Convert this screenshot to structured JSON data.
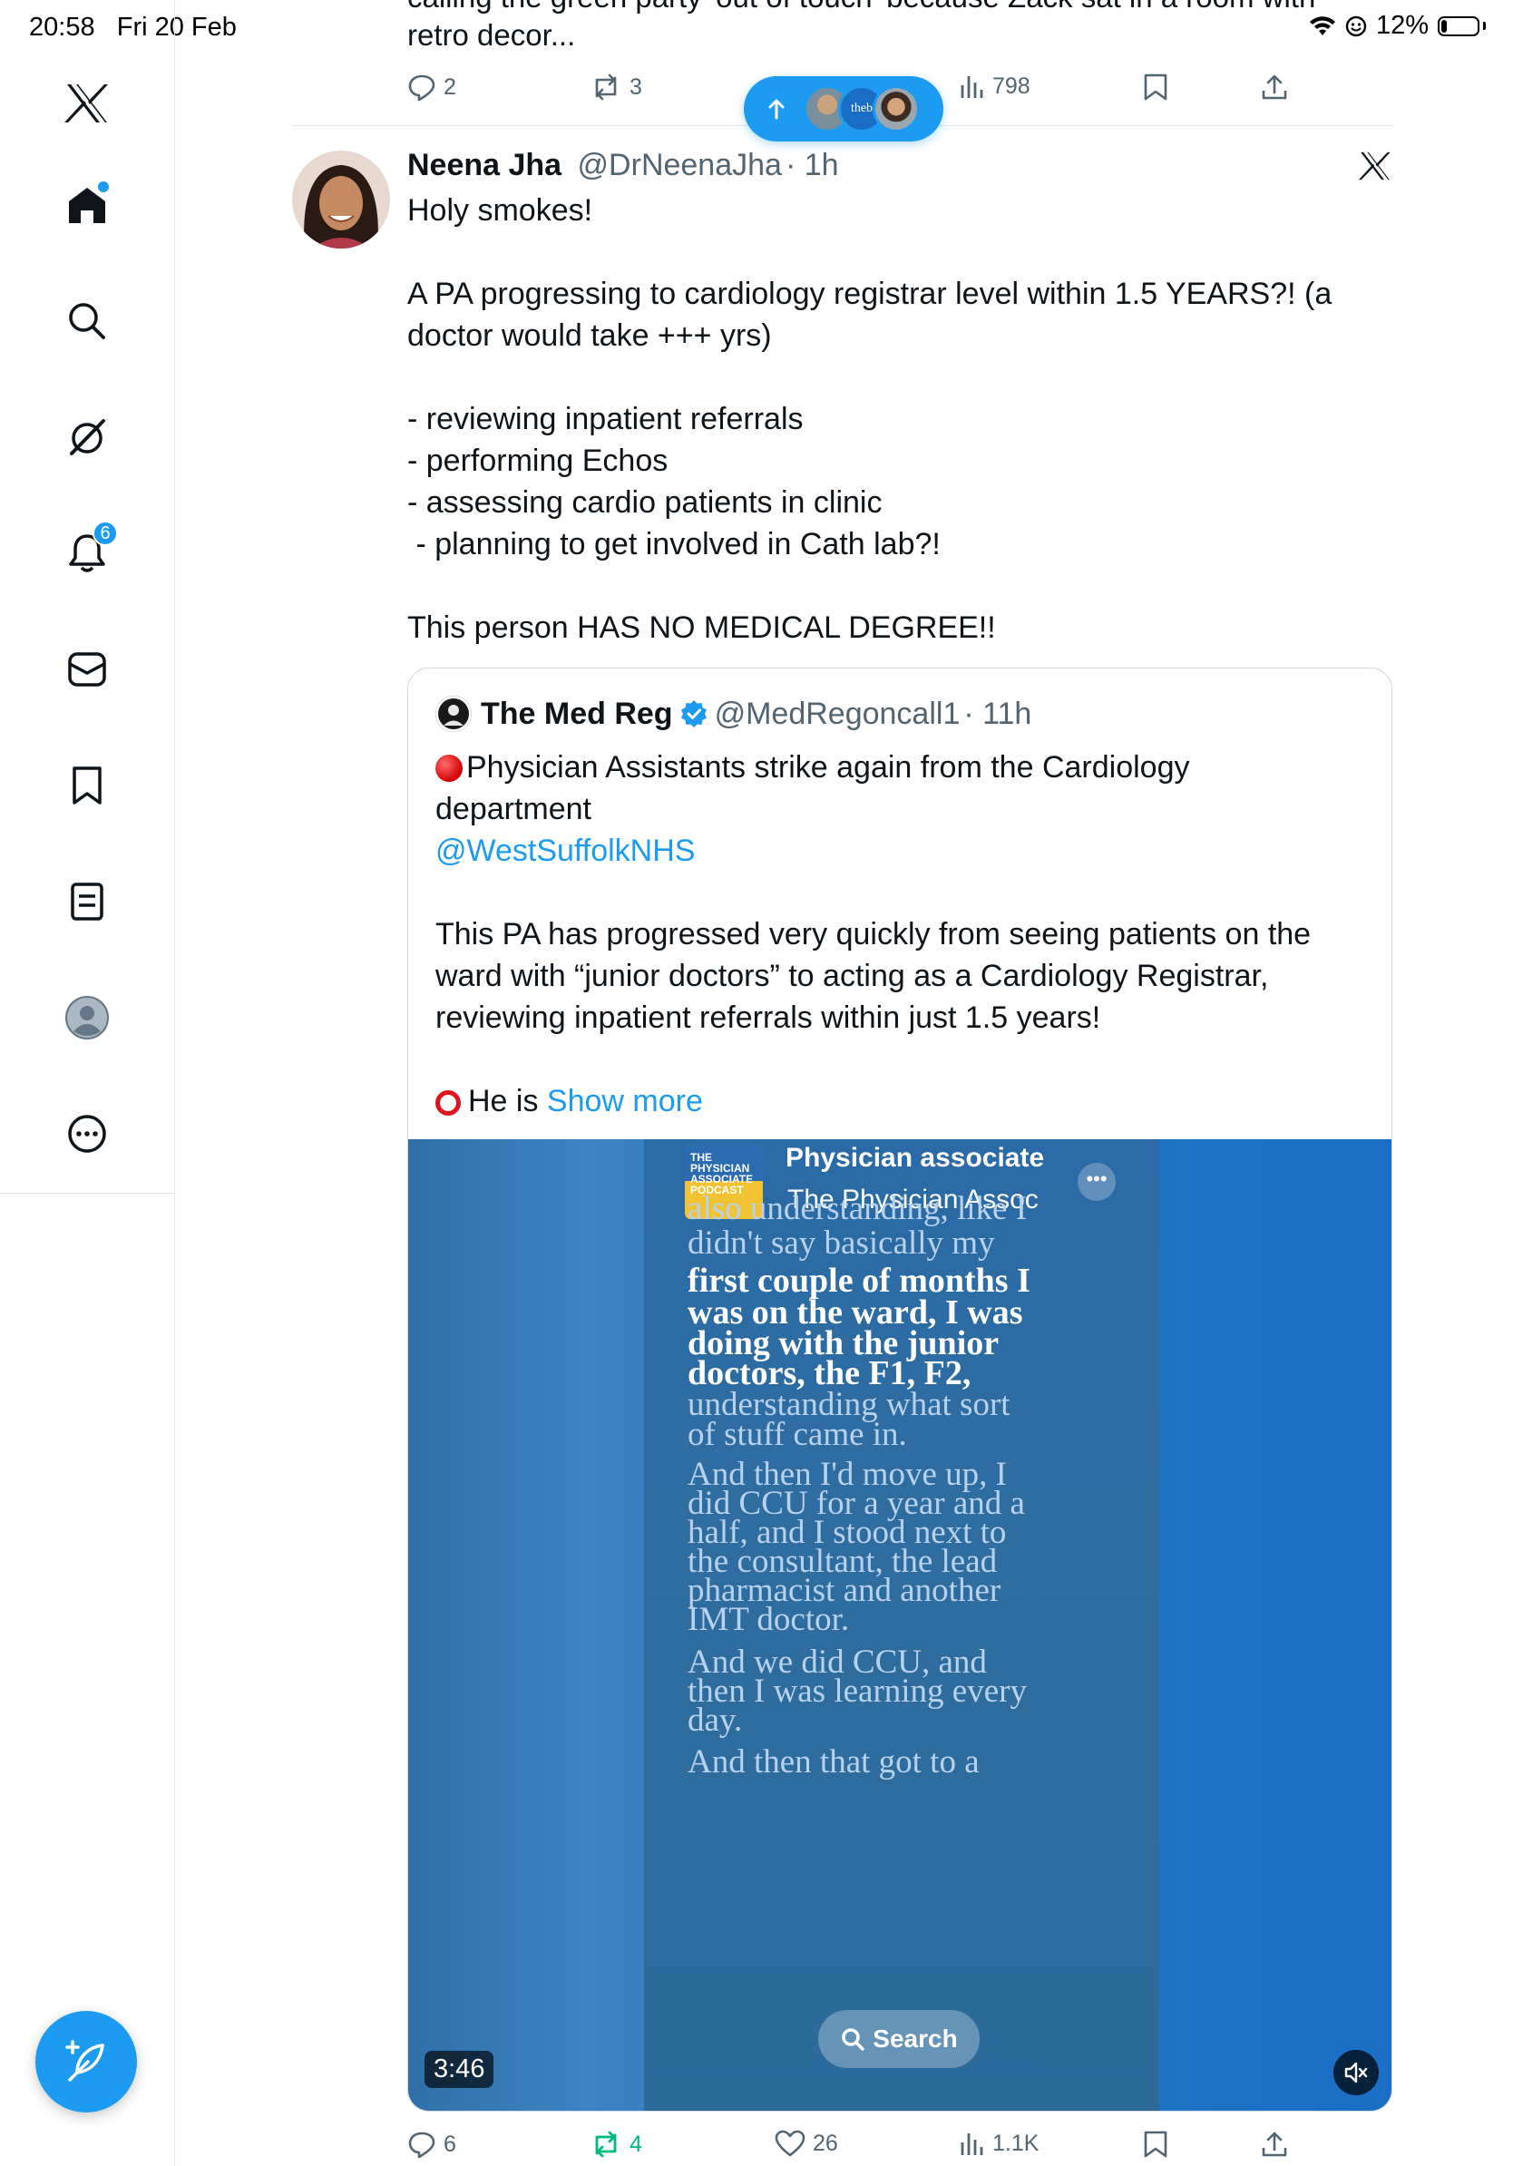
{
  "status_bar": {
    "time": "20:58",
    "date": "Fri 20 Feb",
    "battery": "12%",
    "battery_level": 0.12
  },
  "sidebar": {
    "items": [
      {
        "icon": "x-logo-icon"
      },
      {
        "icon": "home-icon"
      },
      {
        "icon": "search-icon"
      },
      {
        "icon": "grok-icon"
      },
      {
        "icon": "bell-icon",
        "badge": "6"
      },
      {
        "icon": "messages-icon"
      },
      {
        "icon": "bookmark-icon"
      },
      {
        "icon": "lists-icon"
      },
      {
        "icon": "profile-icon"
      },
      {
        "icon": "more-icon"
      }
    ],
    "compose_icon": "compose-feather-icon"
  },
  "previous_tweet": {
    "text_cut": "calling the green party 'out of touch' because Zack sat in a room with",
    "text": "retro decor...",
    "replies": "2",
    "reposts": "3",
    "views": "798"
  },
  "new_posts_pill": {
    "label_fragment": "theb"
  },
  "tweet": {
    "name": "Neena Jha",
    "handle": "@DrNeenaJha",
    "time": "· 1h",
    "lines": [
      "Holy smokes!",
      "",
      "A PA progressing to cardiology registrar level within 1.5 YEARS?! (a",
      "doctor would take +++ yrs)",
      "",
      "- reviewing inpatient referrals",
      "- performing Echos",
      "- assessing cardio patients in clinic",
      " - planning to get involved in Cath lab?!",
      "",
      "This person HAS NO MEDICAL DEGREE!!"
    ],
    "replies": "6",
    "reposts": "4",
    "likes": "26",
    "views": "1.1K"
  },
  "quote": {
    "name": "The Med Reg",
    "handle": "@MedRegoncall1",
    "time": "· 11h",
    "line1": "Physician Assistants strike again from the Cardiology",
    "line2": "department",
    "mention": "@WestSuffolkNHS",
    "para2": "This PA has progressed very quickly from seeing patients on the ward with “junior doctors” to acting as a Cardiology Registrar, reviewing inpatient referrals within just 1.5 years!",
    "he_is": "He is",
    "show_more": "Show more"
  },
  "video": {
    "podcast_title": "Physician associate",
    "podcast_sub": "The Physician Assoc",
    "thumb_text": "THE PHYSICIAN ASSOCIATE PODCAST",
    "captions": [
      {
        "text": "also understanding, like I",
        "style": "dim"
      },
      {
        "text": "didn't say basically my",
        "style": "dim"
      },
      {
        "text": "first couple of months I",
        "style": "bright"
      },
      {
        "text": "was on the ward, I was",
        "style": "bright"
      },
      {
        "text": "doing with the junior",
        "style": "bright"
      },
      {
        "text": "doctors, the F1, F2,",
        "style": "bright"
      },
      {
        "text": "understanding what sort",
        "style": "dim"
      },
      {
        "text": "of stuff came in.",
        "style": "dim"
      },
      {
        "text": "And then I'd move up, I",
        "style": "dim"
      },
      {
        "text": "did CCU for a year and a",
        "style": "dim"
      },
      {
        "text": "half, and I stood next to",
        "style": "dim"
      },
      {
        "text": "the consultant, the lead",
        "style": "dim"
      },
      {
        "text": "pharmacist and another",
        "style": "dim"
      },
      {
        "text": "IMT doctor.",
        "style": "dim"
      },
      {
        "text": "And we did CCU, and",
        "style": "dim"
      },
      {
        "text": "then I was learning every",
        "style": "dim"
      },
      {
        "text": "day.",
        "style": "dim"
      },
      {
        "text": "And then that got to a",
        "style": "dim"
      }
    ],
    "search_label": "Search",
    "duration": "3:46"
  },
  "colors": {
    "accent": "#1d9bf0",
    "repost_green": "#00ba7c",
    "text": "#0f1419",
    "muted": "#536471"
  }
}
